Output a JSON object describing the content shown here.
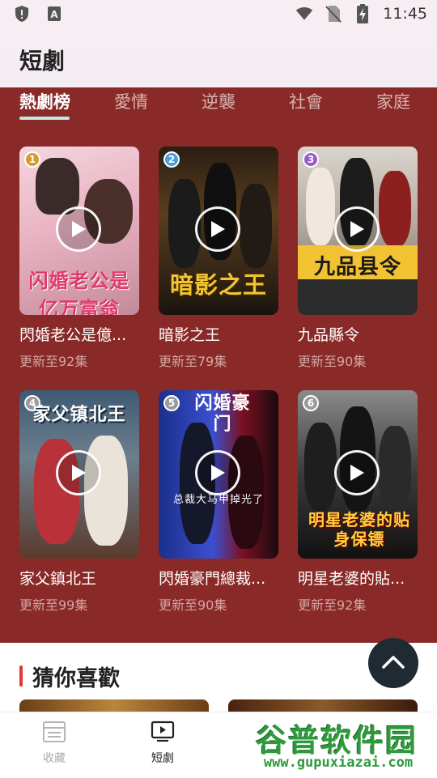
{
  "status_bar": {
    "time": "11:45",
    "left_icons": [
      "shield-icon",
      "keyboard-a-icon"
    ],
    "right_icons": [
      "wifi-icon",
      "no-sim-icon",
      "battery-charging-icon"
    ]
  },
  "header": {
    "title": "短劇"
  },
  "tabs": [
    {
      "label": "熱劇榜",
      "active": true
    },
    {
      "label": "愛情",
      "active": false
    },
    {
      "label": "逆襲",
      "active": false
    },
    {
      "label": "社會",
      "active": false
    },
    {
      "label": "家庭",
      "active": false
    }
  ],
  "dramas": [
    {
      "rank": "1",
      "title": "閃婚老公是億萬富翁",
      "display_title": "閃婚老公是億...",
      "subtitle": "更新至92集",
      "poster_text": "闪婚老公是亿万富翁",
      "rank_color": "#d59a2c"
    },
    {
      "rank": "2",
      "title": "暗影之王",
      "display_title": "暗影之王",
      "subtitle": "更新至79集",
      "poster_text": "暗影之王",
      "rank_color": "#4a9fd8"
    },
    {
      "rank": "3",
      "title": "九品縣令",
      "display_title": "九品縣令",
      "subtitle": "更新至90集",
      "poster_text": "九品县令",
      "rank_color": "#9b59c9"
    },
    {
      "rank": "4",
      "title": "家父鎮北王",
      "display_title": "家父鎮北王",
      "subtitle": "更新至99集",
      "poster_text": "家父镇北王",
      "rank_color": "#9a9a9a"
    },
    {
      "rank": "5",
      "title": "閃婚豪門總裁",
      "display_title": "閃婚豪門總裁...",
      "subtitle": "更新至90集",
      "poster_text": "闪婚豪门",
      "poster_subtext": "总裁大马甲掉光了",
      "rank_color": "#9a9a9a"
    },
    {
      "rank": "6",
      "title": "明星老婆的貼身保鏢",
      "display_title": "明星老婆的貼...",
      "subtitle": "更新至92集",
      "poster_text": "明星老婆的贴身保镖",
      "rank_color": "#9a9a9a"
    }
  ],
  "guess_section": {
    "title": "猜你喜歡"
  },
  "bottom_nav": [
    {
      "label": "收藏",
      "icon": "list-icon",
      "active": false
    },
    {
      "label": "短劇",
      "icon": "tv-play-icon",
      "active": true
    }
  ],
  "watermark": {
    "main": "谷普软件园",
    "url": "www.gupuxiazai.com"
  },
  "colors": {
    "panel": "#8a2a28",
    "accent": "#e03a2f",
    "tab_underline": "#bfe6df",
    "fab": "#1f2a33"
  }
}
